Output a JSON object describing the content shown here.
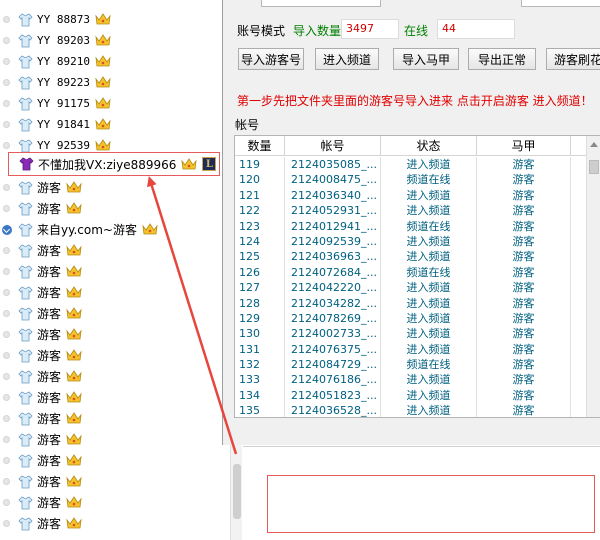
{
  "user_list": {
    "rows": [
      {
        "name": "YY 88873",
        "kind": "yy"
      },
      {
        "name": "YY 89203",
        "kind": "yy"
      },
      {
        "name": "YY 89210",
        "kind": "yy"
      },
      {
        "name": "YY 89223",
        "kind": "yy"
      },
      {
        "name": "YY 91175",
        "kind": "yy"
      },
      {
        "name": "YY 91841",
        "kind": "yy"
      },
      {
        "name": "YY 92539",
        "kind": "yy"
      },
      {
        "name": "不懂加我VX:ziye889966",
        "kind": "promo"
      },
      {
        "name": "游客",
        "kind": "guest"
      },
      {
        "name": "游客",
        "kind": "guest"
      },
      {
        "name": "来自yy.com~游客",
        "kind": "guest-expand"
      },
      {
        "name": "游客",
        "kind": "guest"
      },
      {
        "name": "游客",
        "kind": "guest"
      },
      {
        "name": "游客",
        "kind": "guest"
      },
      {
        "name": "游客",
        "kind": "guest"
      },
      {
        "name": "游客",
        "kind": "guest"
      },
      {
        "name": "游客",
        "kind": "guest"
      },
      {
        "name": "游客",
        "kind": "guest"
      },
      {
        "name": "游客",
        "kind": "guest"
      },
      {
        "name": "游客",
        "kind": "guest"
      },
      {
        "name": "游客",
        "kind": "guest"
      },
      {
        "name": "游客",
        "kind": "guest"
      },
      {
        "name": "游客",
        "kind": "guest"
      },
      {
        "name": "游客",
        "kind": "guest"
      },
      {
        "name": "游客",
        "kind": "guest"
      }
    ],
    "promo_badge": "L"
  },
  "app": {
    "mode_label": "账号模式",
    "import_count_label": "导入数量",
    "import_count_value": "3497",
    "online_label": "在线",
    "online_value": "44",
    "buttons": [
      "导入游客号",
      "进入频道",
      "导入马甲",
      "导出正常",
      "游客刷花"
    ],
    "hint": "第一步先把文件夹里面的游客号导入进来 点击开启游客 进入频道！",
    "account_section_label": "帐号",
    "grid_headers": [
      "数量",
      "帐号",
      "状态",
      "马甲"
    ],
    "grid_rows": [
      [
        "119",
        "2124035085_...",
        "进入频道",
        "游客"
      ],
      [
        "120",
        "2124008475_...",
        "频道在线",
        "游客"
      ],
      [
        "121",
        "2124036340_...",
        "进入频道",
        "游客"
      ],
      [
        "122",
        "2124052931_...",
        "进入频道",
        "游客"
      ],
      [
        "123",
        "2124012941_...",
        "频道在线",
        "游客"
      ],
      [
        "124",
        "2124092539_...",
        "进入频道",
        "游客"
      ],
      [
        "125",
        "2124036963_...",
        "进入频道",
        "游客"
      ],
      [
        "126",
        "2124072684_...",
        "频道在线",
        "游客"
      ],
      [
        "127",
        "2124042220_...",
        "进入频道",
        "游客"
      ],
      [
        "128",
        "2124034282_...",
        "进入频道",
        "游客"
      ],
      [
        "129",
        "2124078269_...",
        "进入频道",
        "游客"
      ],
      [
        "130",
        "2124002733_...",
        "进入频道",
        "游客"
      ],
      [
        "131",
        "2124076375_...",
        "进入频道",
        "游客"
      ],
      [
        "132",
        "2124084729_...",
        "频道在线",
        "游客"
      ],
      [
        "133",
        "2124076186_...",
        "进入频道",
        "游客"
      ],
      [
        "134",
        "2124051823_...",
        "进入频道",
        "游客"
      ],
      [
        "135",
        "2124036528_...",
        "进入频道",
        "游客"
      ],
      [
        "",
        "",
        "进入频道",
        ""
      ]
    ]
  },
  "colors": {
    "hint_red": "#e00000",
    "label_green": "#008000",
    "value_red": "#d00000",
    "grid_text": "#006080",
    "annotation_red": "#e85b5b"
  }
}
